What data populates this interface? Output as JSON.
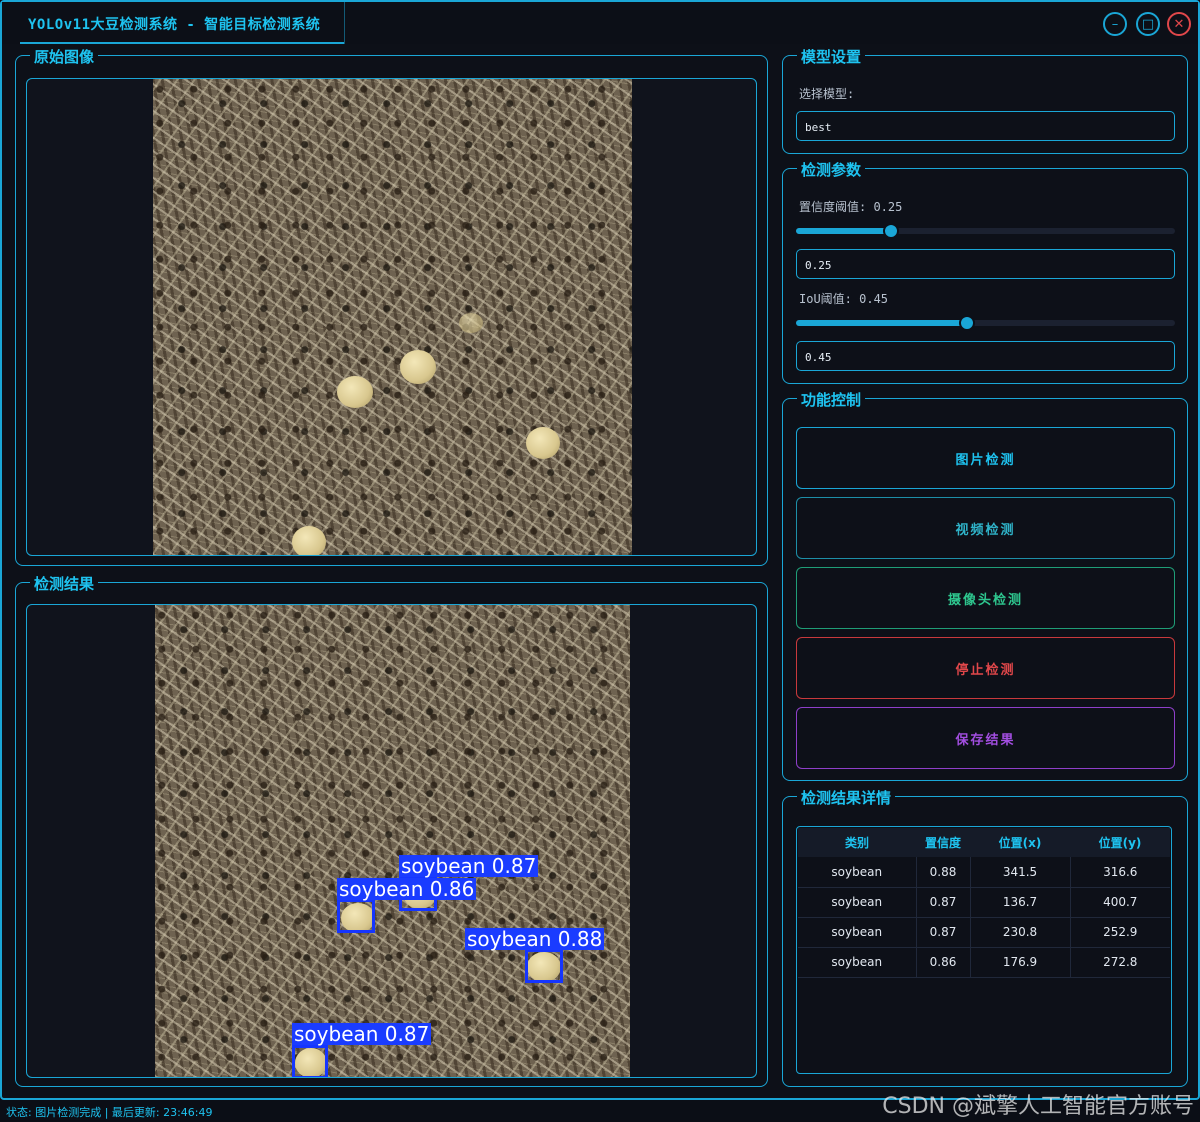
{
  "window": {
    "title": "YOLOv11大豆检测系统 - 智能目标检测系统",
    "minimize_icon": "minimize-icon",
    "maximize_icon": "maximize-icon",
    "close_icon": "close-icon"
  },
  "original_panel": {
    "title": "原始图像"
  },
  "result_panel": {
    "title": "检测结果",
    "detections": [
      {
        "label": "soybean 0.87"
      },
      {
        "label": "soybean 0.86"
      },
      {
        "label": "soybean 0.88"
      },
      {
        "label": "soybean 0.87"
      }
    ]
  },
  "model_settings": {
    "title": "模型设置",
    "select_label": "选择模型:",
    "selected_model": "best"
  },
  "detect_params": {
    "title": "检测参数",
    "confidence_label": "置信度阈值: 0.25",
    "confidence_value": "0.25",
    "confidence_level": 0.25,
    "iou_label": "IoU阈值: 0.45",
    "iou_value": "0.45",
    "iou_level": 0.45
  },
  "function_control": {
    "title": "功能控制",
    "image_detect": "图片检测",
    "video_detect": "视频检测",
    "camera_detect": "摄像头检测",
    "stop_detect": "停止检测",
    "save_results": "保存结果"
  },
  "result_details": {
    "title": "检测结果详情",
    "columns": [
      "类别",
      "置信度",
      "位置(x)",
      "位置(y)"
    ],
    "rows": [
      [
        "soybean",
        "0.88",
        "341.5",
        "316.6"
      ],
      [
        "soybean",
        "0.87",
        "136.7",
        "400.7"
      ],
      [
        "soybean",
        "0.87",
        "230.8",
        "252.9"
      ],
      [
        "soybean",
        "0.86",
        "176.9",
        "272.8"
      ]
    ]
  },
  "status": {
    "text": "状态: 图片检测完成 | 最后更新: 23:46:49"
  },
  "watermark": "CSDN @斌擎人工智能官方账号",
  "colors": {
    "accent": "#1aa6d6",
    "video_btn": "#2fb3c9",
    "camera_btn": "#2ec78f",
    "stop_btn": "#e0474a",
    "save_btn": "#a24ee0",
    "box": "#1a3cff"
  }
}
